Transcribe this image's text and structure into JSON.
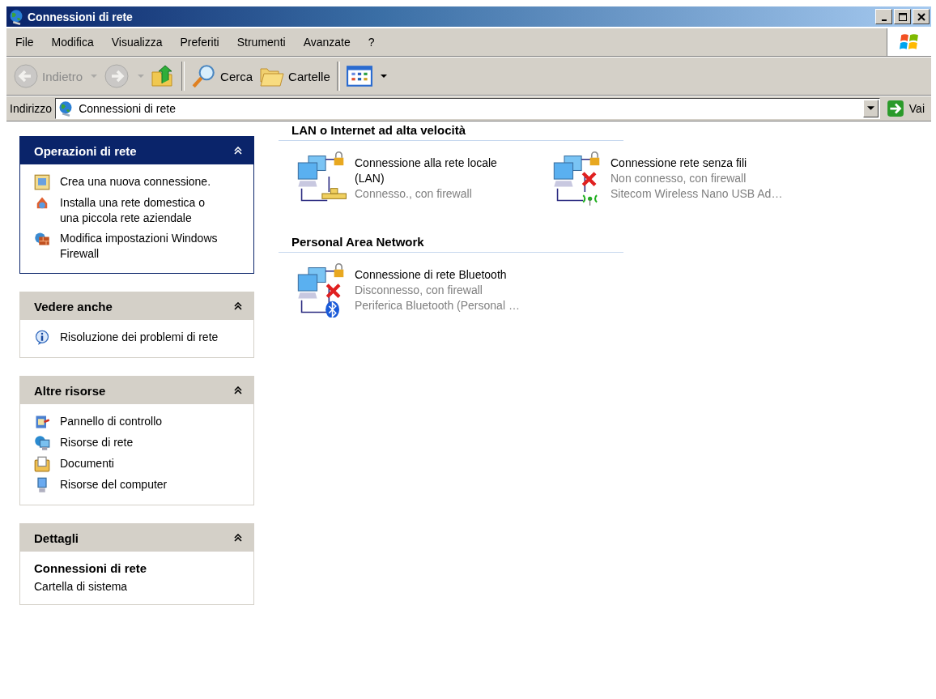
{
  "window": {
    "title": "Connessioni di rete"
  },
  "menu": [
    "File",
    "Modifica",
    "Visualizza",
    "Preferiti",
    "Strumenti",
    "Avanzate",
    "?"
  ],
  "toolbar": [
    {
      "kind": "back",
      "label": "Indietro",
      "disabled": true,
      "dropdown": true
    },
    {
      "kind": "forward",
      "disabled": true,
      "dropdown": true
    },
    {
      "kind": "up",
      "disabled": false,
      "dropdown": false
    },
    {
      "kind": "search",
      "label": "Cerca",
      "disabled": false,
      "dropdown": false
    },
    {
      "kind": "folders",
      "label": "Cartelle",
      "disabled": false,
      "dropdown": false
    },
    {
      "kind": "views",
      "disabled": false,
      "dropdown": true
    }
  ],
  "address": {
    "label": "Indirizzo",
    "value": "Connessioni di rete",
    "go": "Vai"
  },
  "task_panes": [
    {
      "kind": "list",
      "title": "Operazioni di rete",
      "special": true,
      "items": [
        {
          "text": "Crea una nuova connessione."
        },
        {
          "text": "Installa una rete domestica o una piccola rete aziendale"
        },
        {
          "text": "Modifica impostazioni Windows Firewall"
        }
      ]
    },
    {
      "kind": "list",
      "title": "Vedere anche",
      "special": false,
      "items": [
        {
          "text": "Risoluzione dei problemi di rete"
        }
      ]
    },
    {
      "kind": "list",
      "title": "Altre risorse",
      "special": false,
      "items": [
        {
          "text": "Pannello di controllo"
        },
        {
          "text": "Risorse di rete"
        },
        {
          "text": "Documenti"
        },
        {
          "text": "Risorse del computer"
        }
      ]
    },
    {
      "kind": "details",
      "title": "Dettagli",
      "special": false,
      "name": "Connessioni di rete",
      "description": "Cartella di sistema"
    }
  ],
  "groups": [
    {
      "title": "LAN o Internet ad alta velocità",
      "connections": [
        {
          "kind": "lan",
          "connected": true,
          "name": "Connessione alla rete locale (LAN)",
          "status": "Connesso., con firewall"
        },
        {
          "kind": "wireless",
          "connected": false,
          "name": "Connessione rete senza fili",
          "status": "Non connesso, con firewall",
          "device": "Sitecom Wireless Nano USB Ad…"
        }
      ]
    },
    {
      "title": "Personal Area Network",
      "connections": [
        {
          "kind": "bluetooth",
          "connected": false,
          "name": "Connessione di rete Bluetooth",
          "status": "Disconnesso, con firewall",
          "device": "Periferica Bluetooth (Personal …"
        }
      ]
    }
  ]
}
